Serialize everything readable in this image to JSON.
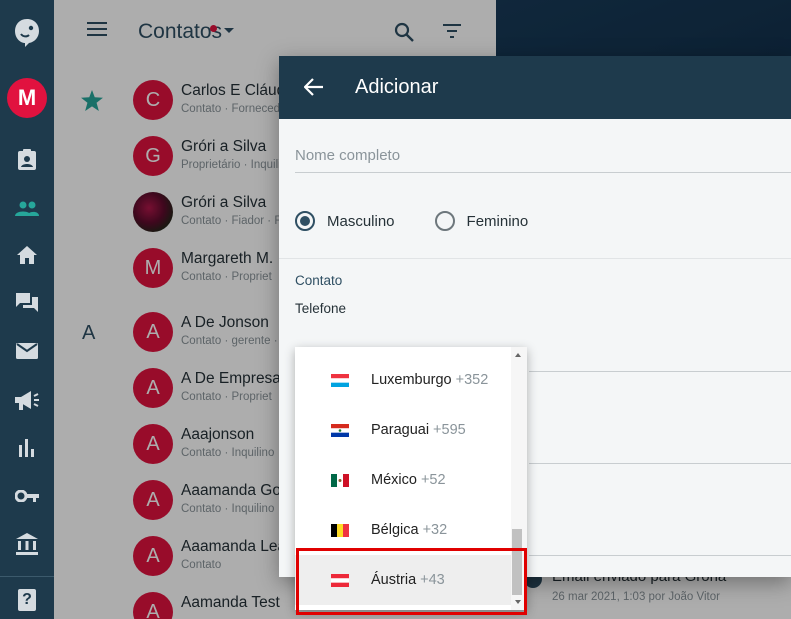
{
  "rail": {
    "user_initial": "M",
    "items": [
      "logo-icon",
      "contact-card-icon",
      "people-icon",
      "home-icon",
      "chat-icon",
      "mail-icon",
      "megaphone-icon",
      "bar-chart-icon",
      "key-icon",
      "bank-icon"
    ],
    "help_label": "?"
  },
  "list": {
    "title": "Contatos",
    "section_letter": "A",
    "rows": [
      {
        "initial": "C",
        "name": "Carlos E Cláud",
        "sub": "Contato · Forneced"
      },
      {
        "initial": "G",
        "name": "Gróri a Silva",
        "sub": "Proprietário · Inquili"
      },
      {
        "initial": "",
        "name": "Gróri a Silva",
        "sub": "Contato · Fiador · F"
      },
      {
        "initial": "M",
        "name": "Margareth M.",
        "sub": "Contato · Propriet"
      },
      {
        "initial": "A",
        "name": "A De Jonson",
        "sub": "Contato · gerente ·"
      },
      {
        "initial": "A",
        "name": "A De Empresa",
        "sub": "Contato · Propriet"
      },
      {
        "initial": "A",
        "name": "Aaajonson",
        "sub": "Contato · Inquilino"
      },
      {
        "initial": "A",
        "name": "Aaamanda Go",
        "sub": "Contato · Inquilino"
      },
      {
        "initial": "A",
        "name": "Aaamanda Lea",
        "sub": "Contato"
      },
      {
        "initial": "A",
        "name": "Aamanda Test",
        "sub": ""
      }
    ]
  },
  "activity": {
    "title": "Email enviado para Grória",
    "sub": "26 mar 2021, 1:03 por João Vitor"
  },
  "dialog": {
    "title": "Adicionar",
    "name_placeholder": "Nome completo",
    "gender_male": "Masculino",
    "gender_female": "Feminino",
    "selected_gender": "Masculino",
    "section_contact": "Contato",
    "phone_label": "Telefone"
  },
  "dropdown": {
    "options": [
      {
        "country": "Luxemburgo",
        "code": "+352",
        "flag": "luxembourg-flag-icon"
      },
      {
        "country": "Paraguai",
        "code": "+595",
        "flag": "paraguay-flag-icon"
      },
      {
        "country": "México",
        "code": "+52",
        "flag": "mexico-flag-icon"
      },
      {
        "country": "Bélgica",
        "code": "+32",
        "flag": "belgium-flag-icon"
      },
      {
        "country": "Áustria",
        "code": "+43",
        "flag": "austria-flag-icon"
      }
    ],
    "highlighted": "Áustria"
  },
  "colors": {
    "rail_bg": "#1e3a4c",
    "accent_red": "#e1123f",
    "teal_active": "#26a69a",
    "highlight_border": "#e00000"
  }
}
